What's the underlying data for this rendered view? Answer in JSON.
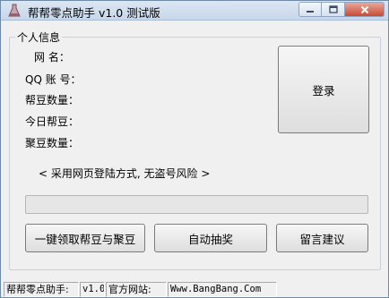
{
  "window": {
    "title": "帮帮零点助手 v1.0 测试版",
    "icon": "flask-icon",
    "controls": [
      "minimize-icon",
      "maximize-icon",
      "close-icon"
    ]
  },
  "group": {
    "title": "个人信息",
    "fields": [
      {
        "label": "网  名："
      },
      {
        "label": "QQ 账 号："
      },
      {
        "label": "帮豆数量："
      },
      {
        "label": "今日帮豆："
      },
      {
        "label": "聚豆数量："
      }
    ]
  },
  "login_button": "登录",
  "notice": "< 采用网页登陆方式, 无盗号风险 >",
  "progress": {
    "value": 0
  },
  "buttons": {
    "collect": "一键领取帮豆与聚豆",
    "lottery": "自动抽奖",
    "feedback": "留言建议"
  },
  "statusbar": {
    "app_name": "帮帮零点助手:",
    "version": "v1.0",
    "site_label": "官方网站:",
    "site_url": "Www.BangBang.Com"
  }
}
